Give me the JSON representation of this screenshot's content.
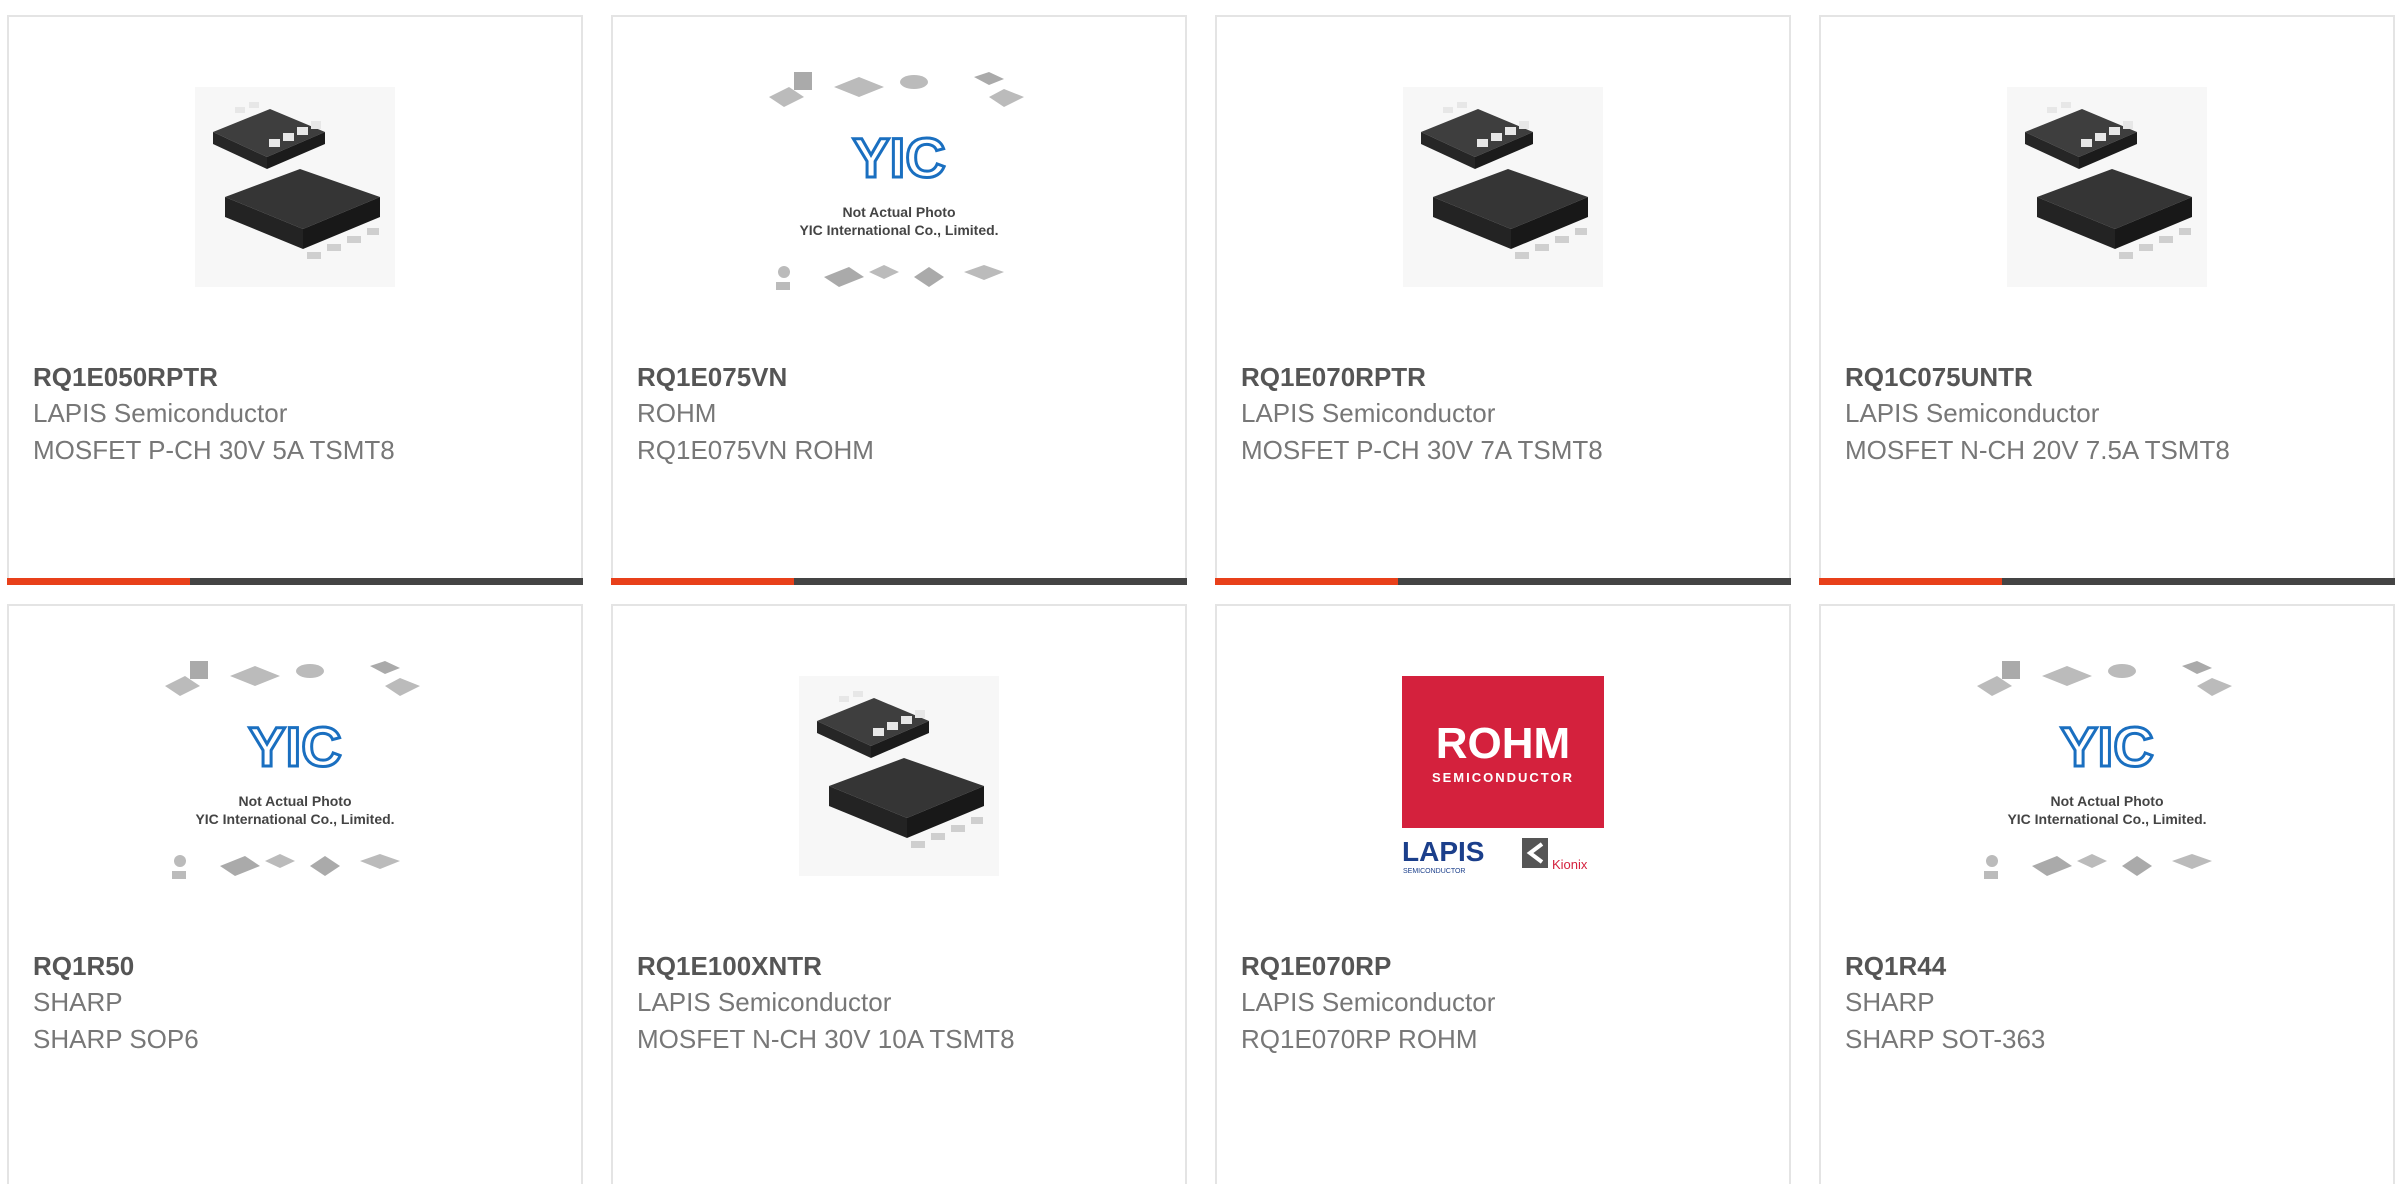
{
  "products": [
    {
      "part": "RQ1E050RPTR",
      "maker": "LAPIS Semiconductor",
      "desc": "MOSFET P-CH 30V 5A TSMT8",
      "image": "chip-photo"
    },
    {
      "part": "RQ1E075VN",
      "maker": "ROHM",
      "desc": "RQ1E075VN ROHM",
      "image": "placeholder"
    },
    {
      "part": "RQ1E070RPTR",
      "maker": "LAPIS Semiconductor",
      "desc": "MOSFET P-CH 30V 7A TSMT8",
      "image": "chip-photo"
    },
    {
      "part": "RQ1C075UNTR",
      "maker": "LAPIS Semiconductor",
      "desc": "MOSFET N-CH 20V 7.5A TSMT8",
      "image": "chip-photo"
    },
    {
      "part": "RQ1R50",
      "maker": "SHARP",
      "desc": "SHARP SOP6",
      "image": "placeholder"
    },
    {
      "part": "RQ1E100XNTR",
      "maker": "LAPIS Semiconductor",
      "desc": "MOSFET N-CH 30V 10A TSMT8",
      "image": "chip-photo"
    },
    {
      "part": "RQ1E070RP",
      "maker": "LAPIS Semiconductor",
      "desc": "RQ1E070RP ROHM",
      "image": "brand-logo"
    },
    {
      "part": "RQ1R44",
      "maker": "SHARP",
      "desc": "SHARP SOT-363",
      "image": "placeholder"
    }
  ],
  "placeholder": {
    "logo": "YIC",
    "line1": "Not Actual Photo",
    "line2": "YIC International Co., Limited."
  },
  "brand_logo": {
    "rohm": "ROHM",
    "rohm_sub": "SEMICONDUCTOR",
    "lapis": "LAPIS",
    "lapis_sub": "SEMICONDUCTOR",
    "kionix": "Kionix"
  },
  "colors": {
    "accent": "#e8401a",
    "bar": "#444444",
    "border": "#e4e4e4",
    "rohm_red": "#d4213d",
    "lapis_blue": "#1b3f8b",
    "yic_blue": "#1a6fc0"
  }
}
